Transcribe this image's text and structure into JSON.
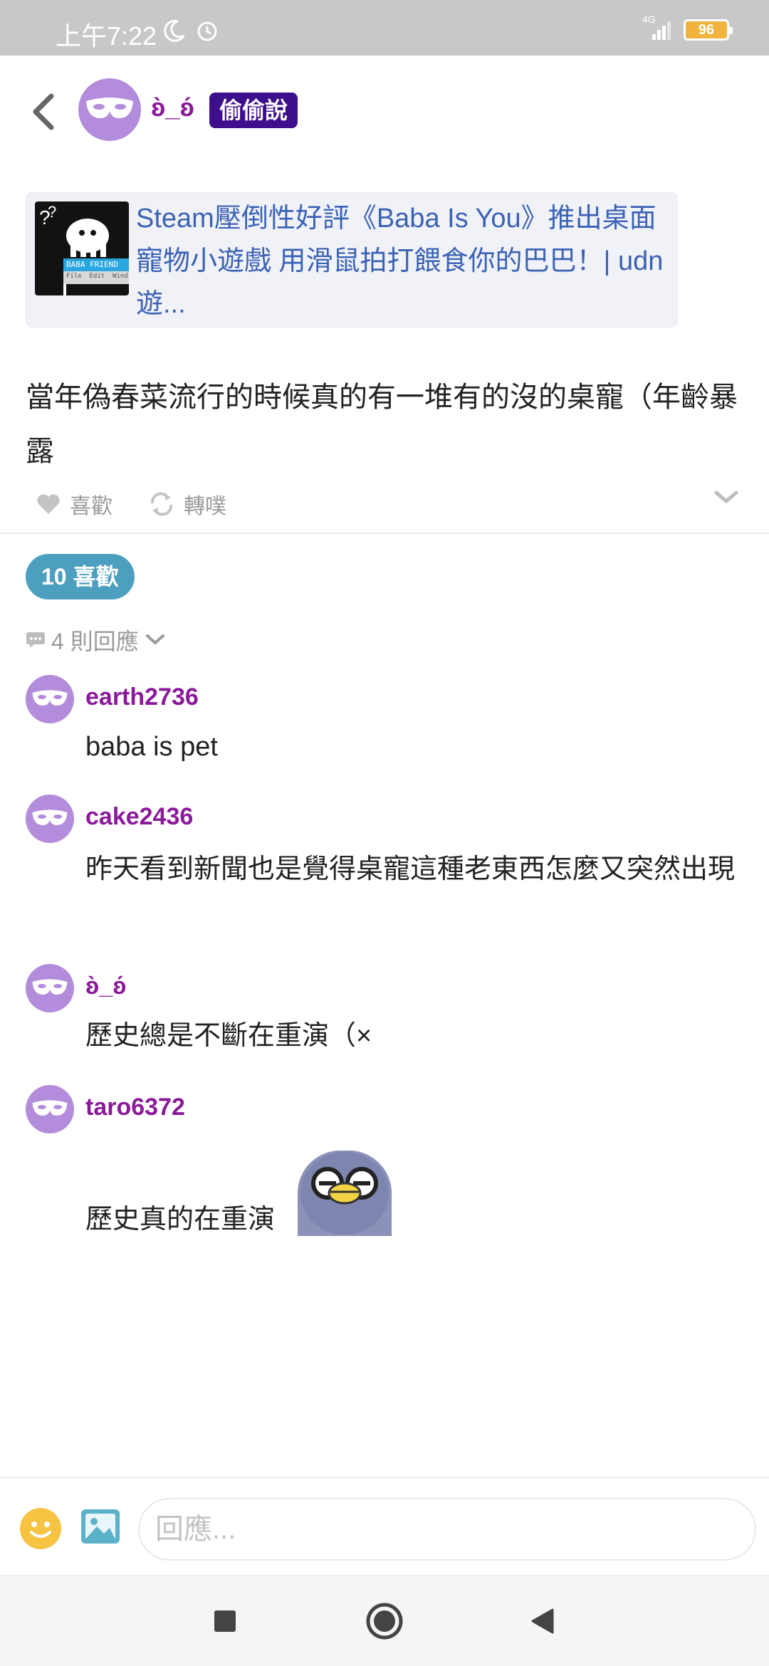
{
  "status_bar": {
    "time": "上午7:22",
    "network": "4G",
    "battery": "96"
  },
  "header": {
    "author": "ʚ̀_ʚ́",
    "badge": "偷偷說"
  },
  "link_card": {
    "title": "Steam壓倒性好評《Baba Is You》推出桌面寵物小遊戲 用滑鼠拍打餵食你的巴巴！| udn遊...",
    "thumb_caption": "BABA FRIEND",
    "thumb_menu": "File  Edit  Wind"
  },
  "post": {
    "body": "當年偽春菜流行的時候真的有一堆有的沒的桌寵（年齡暴露"
  },
  "actions": {
    "like_label": "喜歡",
    "repost_label": "轉噗"
  },
  "likes_pill": "10 喜歡",
  "reply_count": "4 則回應",
  "comments": [
    {
      "author": "earth2736",
      "text": "baba is pet"
    },
    {
      "author": "cake2436",
      "text": "昨天看到新聞也是覺得桌寵這種老東西怎麼又突然出現"
    },
    {
      "author": "ʚ̀_ʚ́",
      "text": "歷史總是不斷在重演（×"
    },
    {
      "author": "taro6372",
      "text": "歷史真的在重演"
    }
  ],
  "input": {
    "placeholder": "回應..."
  },
  "colors": {
    "accent_purple": "#8a1a9a",
    "badge_bg": "#3d0f8c",
    "link_blue": "#3a62b5",
    "likes_pill": "#4d9fbf"
  }
}
